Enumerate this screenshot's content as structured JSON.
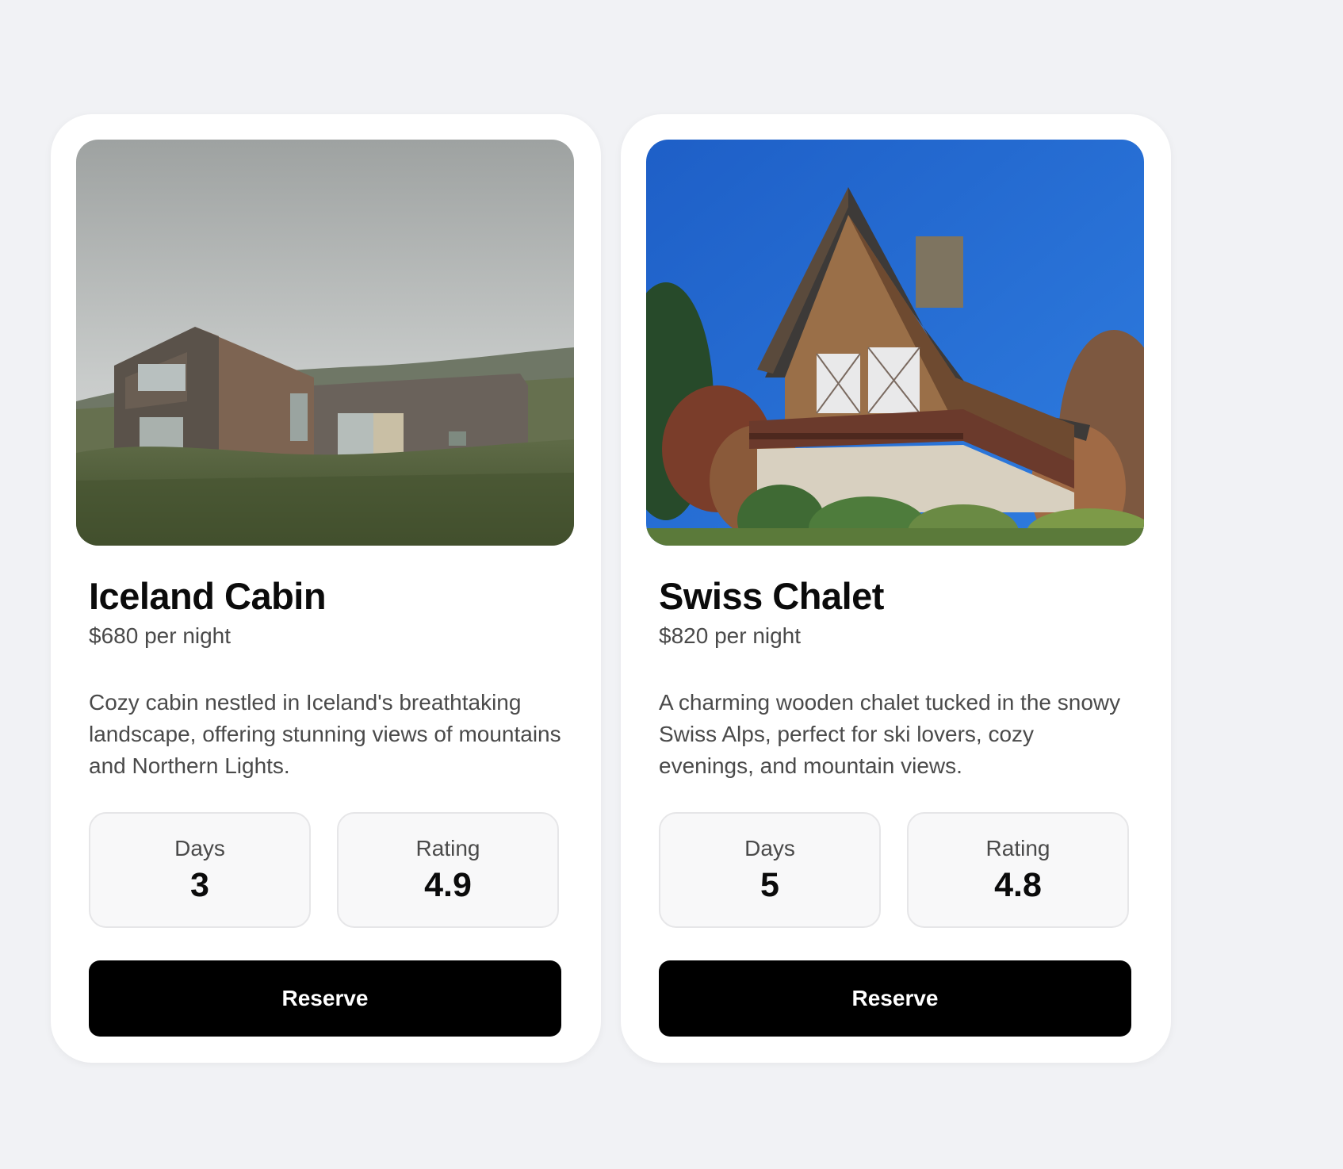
{
  "listings": [
    {
      "title": "Iceland Cabin",
      "price": "$680 per night",
      "description": "Cozy cabin nestled in Iceland's breathtaking landscape, offering stunning views of mountains and Northern Lights.",
      "stats": [
        {
          "label": "Days",
          "value": "3"
        },
        {
          "label": "Rating",
          "value": "4.9"
        }
      ],
      "button_label": "Reserve"
    },
    {
      "title": "Swiss Chalet",
      "price": "$820 per night",
      "description": "A charming wooden chalet tucked in the snowy Swiss Alps, perfect for ski lovers, cozy evenings, and mountain views.",
      "stats": [
        {
          "label": "Days",
          "value": "5"
        },
        {
          "label": "Rating",
          "value": "4.8"
        }
      ],
      "button_label": "Reserve"
    }
  ],
  "colors": {
    "page_background": "#f1f2f5",
    "card_background": "#ffffff",
    "button_background": "#000000",
    "button_text": "#ffffff"
  }
}
